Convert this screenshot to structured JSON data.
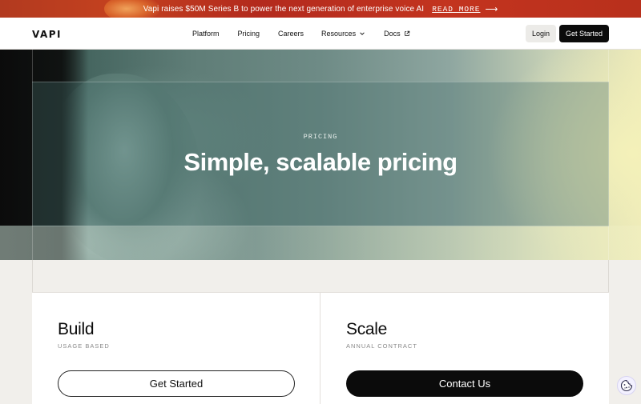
{
  "announcement": {
    "message": "Vapi raises $50M Series B to power the next generation of enterprise voice AI",
    "link_label": "READ MORE",
    "arrow": "⟶"
  },
  "header": {
    "logo": "VAPI",
    "nav": [
      {
        "label": "Platform"
      },
      {
        "label": "Pricing"
      },
      {
        "label": "Careers"
      },
      {
        "label": "Resources",
        "icon": "chevron-down-icon"
      },
      {
        "label": "Docs",
        "icon": "external-link-icon"
      }
    ],
    "login_label": "Login",
    "get_started_label": "Get Started"
  },
  "hero": {
    "eyebrow": "PRICING",
    "title": "Simple, scalable pricing"
  },
  "plans": [
    {
      "name": "Build",
      "subtitle": "USAGE BASED",
      "cta": "Get Started"
    },
    {
      "name": "Scale",
      "subtitle": "ANNUAL CONTRACT",
      "cta": "Contact Us"
    }
  ],
  "cookie_button": {
    "icon": "cookie-icon"
  },
  "colors": {
    "announcement_bg": "#b8301c",
    "primary_button": "#0b0b0b",
    "page_bg": "#f1efeb"
  }
}
